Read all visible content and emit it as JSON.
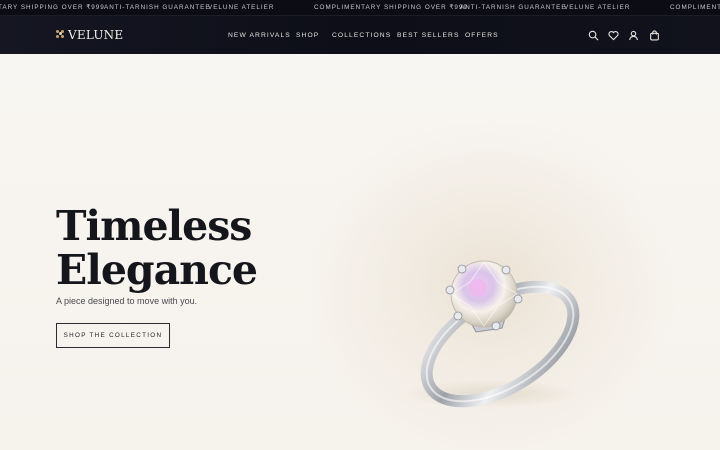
{
  "announcement": {
    "items": [
      "TARY SHIPPING OVER ₹999",
      "ANTI-TARNISH GUARANTEE",
      "VELUNE ATELIER",
      "COMPLIMENTARY SHIPPING OVER ₹999",
      "ANTI-TARNISH GUARANTEE",
      "VELUNE ATELIER",
      "COMPLIMENTA"
    ]
  },
  "header": {
    "logo": "VELUNE",
    "nav": [
      "NEW ARRIVALS",
      "SHOP",
      "COLLECTIONS",
      "BEST SELLERS",
      "OFFERS"
    ],
    "icons": [
      "search-icon",
      "heart-icon",
      "user-icon",
      "bag-icon"
    ]
  },
  "hero": {
    "title_line1": "Timeless",
    "title_line2": "Elegance",
    "subtitle": "A piece designed to move with you.",
    "cta": "SHOP THE COLLECTION"
  },
  "colors": {
    "topbar": "#0b0c14",
    "header": "#11121c",
    "background": "#f7f4ef",
    "text": "#15161c",
    "logo_accent": "#c7a36a"
  }
}
